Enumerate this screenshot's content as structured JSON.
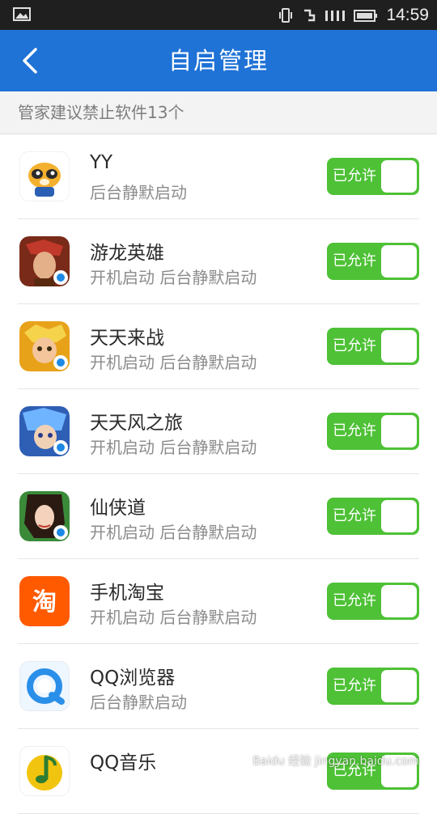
{
  "status_bar": {
    "time": "14:59",
    "icons": [
      "image-icon",
      "vibrate-icon",
      "data-icon",
      "signal-icon",
      "battery-icon"
    ]
  },
  "header": {
    "title": "自启管理",
    "back_icon": "chevron-left-icon"
  },
  "notice": {
    "text": "管家建议禁止软件13个"
  },
  "apps": [
    {
      "name": "YY",
      "desc": "后台静默启动",
      "toggle_label": "已允许",
      "icon": "yy-icon",
      "color": "#f6b23a"
    },
    {
      "name": "游龙英雄",
      "desc": "开机启动 后台静默启动",
      "toggle_label": "已允许",
      "icon": "game-icon",
      "color": "#7a2a18"
    },
    {
      "name": "天天来战",
      "desc": "开机启动 后台静默启动",
      "toggle_label": "已允许",
      "icon": "game-icon",
      "color": "#e8a21a"
    },
    {
      "name": "天天风之旅",
      "desc": "开机启动 后台静默启动",
      "toggle_label": "已允许",
      "icon": "game-icon",
      "color": "#2f5fb5"
    },
    {
      "name": "仙侠道",
      "desc": "开机启动 后台静默启动",
      "toggle_label": "已允许",
      "icon": "game-icon",
      "color": "#3a8a3a"
    },
    {
      "name": "手机淘宝",
      "desc": "开机启动 后台静默启动",
      "toggle_label": "已允许",
      "icon": "taobao-icon",
      "color": "#ff5a00",
      "icon_text": "淘"
    },
    {
      "name": "QQ浏览器",
      "desc": "后台静默启动",
      "toggle_label": "已允许",
      "icon": "qq-browser-icon",
      "color": "#2a8fe8"
    },
    {
      "name": "QQ音乐",
      "desc": "",
      "toggle_label": "已允许",
      "icon": "qq-music-icon",
      "color": "#f1c40f"
    }
  ],
  "colors": {
    "header": "#1f72d6",
    "toggle_on": "#4ec136",
    "status_bar": "#1f1f1f"
  },
  "watermark": "Baidu 经验  jingyan.baidu.com"
}
